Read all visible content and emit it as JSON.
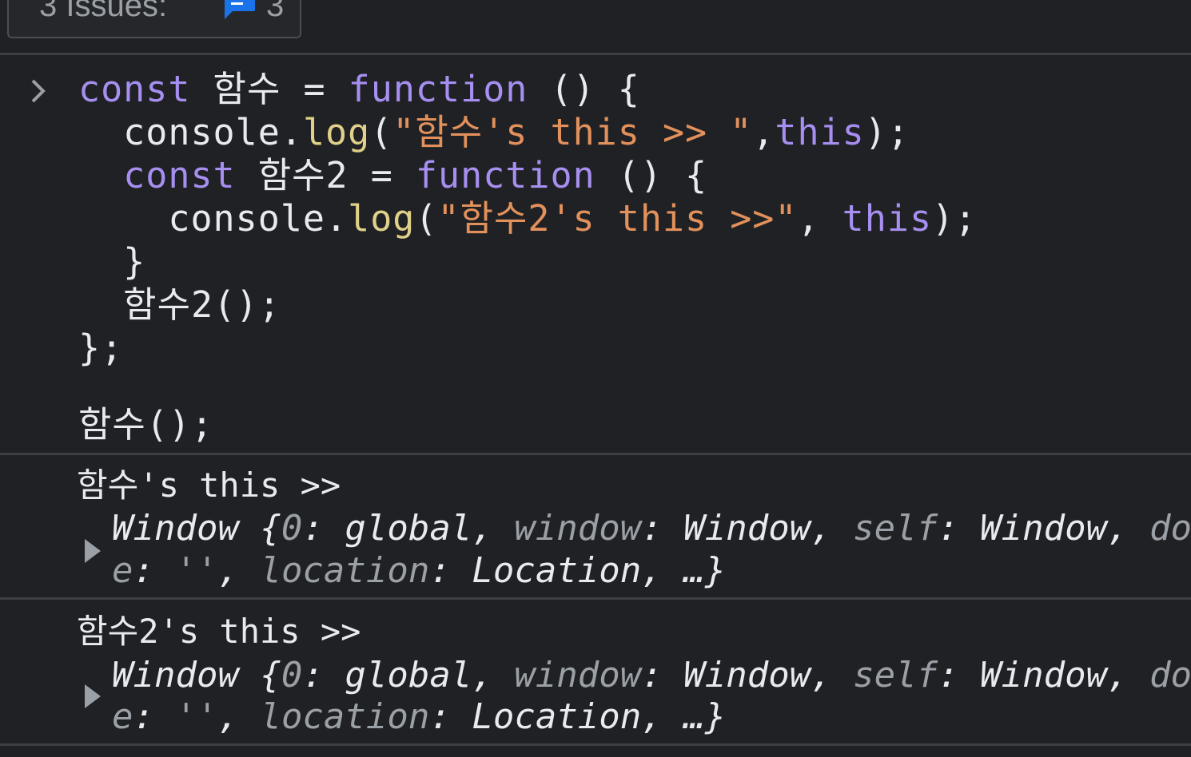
{
  "issues": {
    "label": "3 Issues:",
    "icon": "message-issue-icon",
    "count": "3",
    "icon_color": "#1a73e8"
  },
  "console_input": {
    "lines": [
      {
        "tokens": [
          [
            "kw2",
            "const"
          ],
          [
            "plain",
            " 함수 = "
          ],
          [
            "kw2",
            "function"
          ],
          [
            "plain",
            " () {"
          ]
        ]
      },
      {
        "tokens": [
          [
            "plain",
            "  console."
          ],
          [
            "fn",
            "log"
          ],
          [
            "plain",
            "("
          ],
          [
            "str",
            "\"함수's this >> \""
          ],
          [
            "plain",
            ","
          ],
          [
            "kw2",
            "this"
          ],
          [
            "plain",
            ");"
          ]
        ]
      },
      {
        "tokens": [
          [
            "plain",
            "  "
          ],
          [
            "kw2",
            "const"
          ],
          [
            "plain",
            " 함수2 = "
          ],
          [
            "kw2",
            "function"
          ],
          [
            "plain",
            " () {"
          ]
        ]
      },
      {
        "tokens": [
          [
            "plain",
            "    console."
          ],
          [
            "fn",
            "log"
          ],
          [
            "plain",
            "("
          ],
          [
            "str",
            "\"함수2's this >>\""
          ],
          [
            "plain",
            ", "
          ],
          [
            "kw2",
            "this"
          ],
          [
            "plain",
            ");"
          ]
        ]
      },
      {
        "tokens": [
          [
            "plain",
            "  }"
          ]
        ]
      },
      {
        "tokens": [
          [
            "plain",
            "  함수2();"
          ]
        ]
      },
      {
        "tokens": [
          [
            "plain",
            "};"
          ]
        ]
      },
      {
        "tokens": [
          [
            "plain",
            ""
          ]
        ]
      },
      {
        "tokens": [
          [
            "plain",
            "함수();"
          ]
        ]
      }
    ]
  },
  "log_entries": [
    {
      "label": "함수's this >>",
      "object_line1": [
        [
          "plain",
          "Window {"
        ],
        [
          "num",
          "0"
        ],
        [
          "plain",
          ": global, "
        ],
        [
          "prop-muted",
          "window"
        ],
        [
          "plain",
          ": Window, "
        ],
        [
          "prop-muted",
          "self"
        ],
        [
          "plain",
          ": Window, "
        ],
        [
          "prop-muted",
          "do"
        ]
      ],
      "object_line2": [
        [
          "prop-muted",
          "e"
        ],
        [
          "plain",
          ": "
        ],
        [
          "num",
          "''"
        ],
        [
          "plain",
          ", "
        ],
        [
          "prop-muted",
          "location"
        ],
        [
          "plain",
          ": Location, …}"
        ]
      ]
    },
    {
      "label": "함수2's this >>",
      "object_line1": [
        [
          "plain",
          "Window {"
        ],
        [
          "num",
          "0"
        ],
        [
          "plain",
          ": global, "
        ],
        [
          "prop-muted",
          "window"
        ],
        [
          "plain",
          ": Window, "
        ],
        [
          "prop-muted",
          "self"
        ],
        [
          "plain",
          ": Window, "
        ],
        [
          "prop-muted",
          "do"
        ]
      ],
      "object_line2": [
        [
          "prop-muted",
          "e"
        ],
        [
          "plain",
          ": "
        ],
        [
          "num",
          "''"
        ],
        [
          "plain",
          ", "
        ],
        [
          "prop-muted",
          "location"
        ],
        [
          "plain",
          ": Location, …}"
        ]
      ]
    }
  ],
  "icons": {
    "prompt": "chevron-right-icon",
    "expand": "triangle-right-icon"
  }
}
